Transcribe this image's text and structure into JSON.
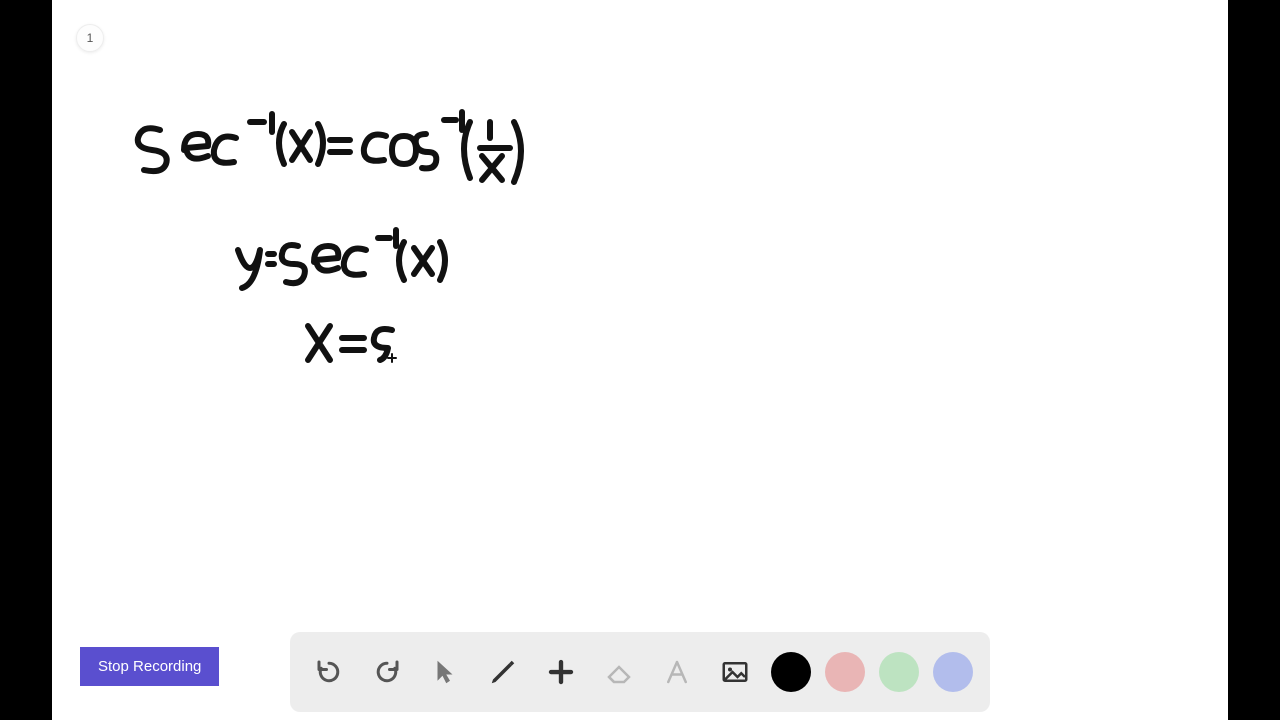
{
  "page": {
    "number": "1"
  },
  "handwriting": {
    "line1": "sec⁻¹(x) = cos⁻¹(1/x)",
    "line2": "y = sec⁻¹(x)",
    "line3": "x = s"
  },
  "controls": {
    "stop_label": "Stop Recording"
  },
  "toolbar": {
    "undo": "undo",
    "redo": "redo",
    "pointer": "pointer",
    "pen": "pen",
    "add": "add",
    "eraser": "eraser",
    "text": "text",
    "image": "image"
  },
  "colors": {
    "black": "#000000",
    "pink": "#e9b5b5",
    "green": "#bde3c1",
    "blue": "#b2bdec"
  }
}
